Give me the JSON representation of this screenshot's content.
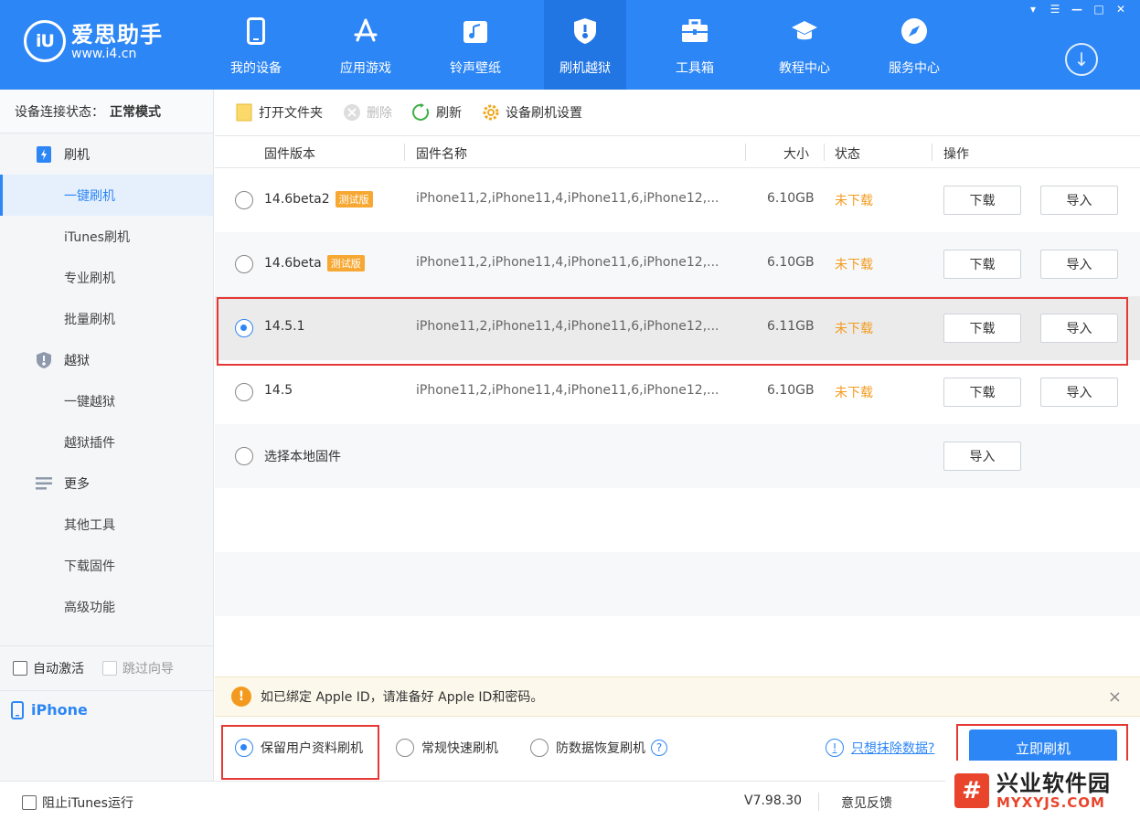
{
  "app": {
    "title": "爱思助手",
    "url": "www.i4.cn",
    "logo_mark": "iU"
  },
  "window_controls": [
    "shirt-icon",
    "menu-icon",
    "minimize-icon",
    "maximize-icon",
    "close-icon"
  ],
  "nav": [
    {
      "label": "我的设备",
      "icon": "phone-icon"
    },
    {
      "label": "应用游戏",
      "icon": "app-store-icon"
    },
    {
      "label": "铃声壁纸",
      "icon": "music-icon"
    },
    {
      "label": "刷机越狱",
      "icon": "shield-icon",
      "active": true
    },
    {
      "label": "工具箱",
      "icon": "toolbox-icon"
    },
    {
      "label": "教程中心",
      "icon": "graduation-cap-icon"
    },
    {
      "label": "服务中心",
      "icon": "compass-icon"
    }
  ],
  "sidebar": {
    "status_label": "设备连接状态：",
    "status_value": "正常模式",
    "groups": [
      {
        "label": "刷机",
        "icon": "flash-icon",
        "items": [
          "一键刷机",
          "iTunes刷机",
          "专业刷机",
          "批量刷机"
        ]
      },
      {
        "label": "越狱",
        "icon": "shield-icon",
        "items": [
          "一键越狱",
          "越狱插件"
        ]
      },
      {
        "label": "更多",
        "icon": "menu-lines-icon",
        "items": [
          "其他工具",
          "下载固件",
          "高级功能"
        ]
      }
    ],
    "active_item": "一键刷机",
    "auto_activate": "自动激活",
    "skip_guide": "跳过向导",
    "device_name": "iPhone"
  },
  "toolbar": {
    "open_folder": "打开文件夹",
    "delete": "删除",
    "refresh": "刷新",
    "settings": "设备刷机设置"
  },
  "table": {
    "headers": {
      "version": "固件版本",
      "name": "固件名称",
      "size": "大小",
      "status": "状态",
      "action": "操作"
    },
    "rows": [
      {
        "version": "14.6beta2",
        "badge": "测试版",
        "name": "iPhone11,2,iPhone11,4,iPhone11,6,iPhone12,...",
        "size": "6.10GB",
        "status": "未下载",
        "download": "下载",
        "import": "导入"
      },
      {
        "version": "14.6beta",
        "badge": "测试版",
        "name": "iPhone11,2,iPhone11,4,iPhone11,6,iPhone12,...",
        "size": "6.10GB",
        "status": "未下载",
        "download": "下载",
        "import": "导入"
      },
      {
        "version": "14.5.1",
        "badge": "",
        "name": "iPhone11,2,iPhone11,4,iPhone11,6,iPhone12,...",
        "size": "6.11GB",
        "status": "未下载",
        "download": "下载",
        "import": "导入",
        "selected": true
      },
      {
        "version": "14.5",
        "badge": "",
        "name": "iPhone11,2,iPhone11,4,iPhone11,6,iPhone12,...",
        "size": "6.10GB",
        "status": "未下载",
        "download": "下载",
        "import": "导入"
      }
    ],
    "local_label": "选择本地固件",
    "local_import": "导入"
  },
  "notice": {
    "text": "如已绑定 Apple ID，请准备好 Apple ID和密码。",
    "close": "×"
  },
  "flash_options": {
    "keep_data": "保留用户资料刷机",
    "quick": "常规快速刷机",
    "anti_recovery": "防数据恢复刷机",
    "help": "?",
    "erase_link": "只想抹除数据?",
    "flash_now": "立即刷机"
  },
  "footer": {
    "block_itunes": "阻止iTunes运行",
    "version": "V7.98.30",
    "feedback": "意见反馈"
  },
  "watermark": {
    "cn": "兴业软件园",
    "en": "MYXYJS.COM"
  },
  "colors": {
    "primary": "#2d86f5",
    "highlight_border": "#e53935",
    "status_orange": "#f39a1e"
  }
}
